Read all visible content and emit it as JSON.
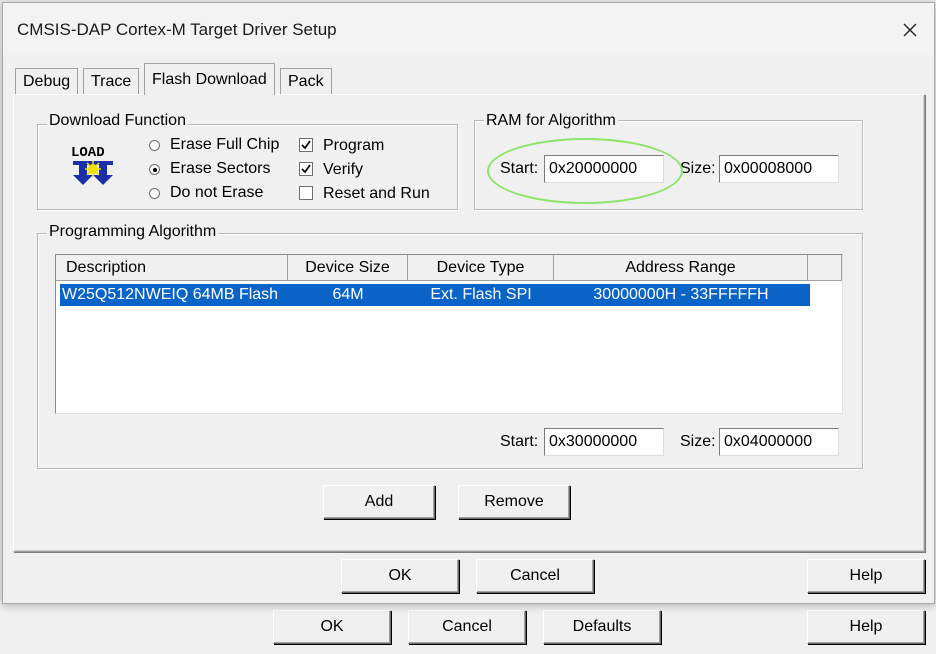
{
  "window": {
    "title": "CMSIS-DAP Cortex-M Target Driver Setup"
  },
  "tabs": [
    {
      "label": "Debug"
    },
    {
      "label": "Trace"
    },
    {
      "label": "Flash Download"
    },
    {
      "label": "Pack"
    }
  ],
  "download_function": {
    "label": "Download Function",
    "erase_options": [
      {
        "label": "Erase Full Chip",
        "selected": false
      },
      {
        "label": "Erase Sectors",
        "selected": true
      },
      {
        "label": "Do not Erase",
        "selected": false
      }
    ],
    "checks": [
      {
        "label": "Program",
        "checked": true
      },
      {
        "label": "Verify",
        "checked": true
      },
      {
        "label": "Reset and Run",
        "checked": false
      }
    ]
  },
  "ram": {
    "label": "RAM for Algorithm",
    "start_label": "Start:",
    "start_value": "0x20000000",
    "size_label": "Size:",
    "size_value": "0x00008000"
  },
  "programming": {
    "label": "Programming Algorithm",
    "columns": [
      "Description",
      "Device Size",
      "Device Type",
      "Address Range"
    ],
    "rows": [
      {
        "description": "W25Q512NWEIQ 64MB Flash",
        "device_size": "64M",
        "device_type": "Ext. Flash SPI",
        "address_range": "30000000H - 33FFFFFH"
      }
    ],
    "start_label": "Start:",
    "start_value": "0x30000000",
    "size_label": "Size:",
    "size_value": "0x04000000",
    "add_label": "Add",
    "remove_label": "Remove"
  },
  "dialog_buttons": {
    "ok": "OK",
    "cancel": "Cancel",
    "help": "Help"
  },
  "parent_buttons": {
    "ok": "OK",
    "cancel": "Cancel",
    "defaults": "Defaults",
    "help": "Help"
  },
  "colors": {
    "selection": "#0a64c8",
    "highlight_oval": "#8ee36b"
  },
  "icons": {
    "load": "load-icon",
    "close": "close-icon"
  }
}
